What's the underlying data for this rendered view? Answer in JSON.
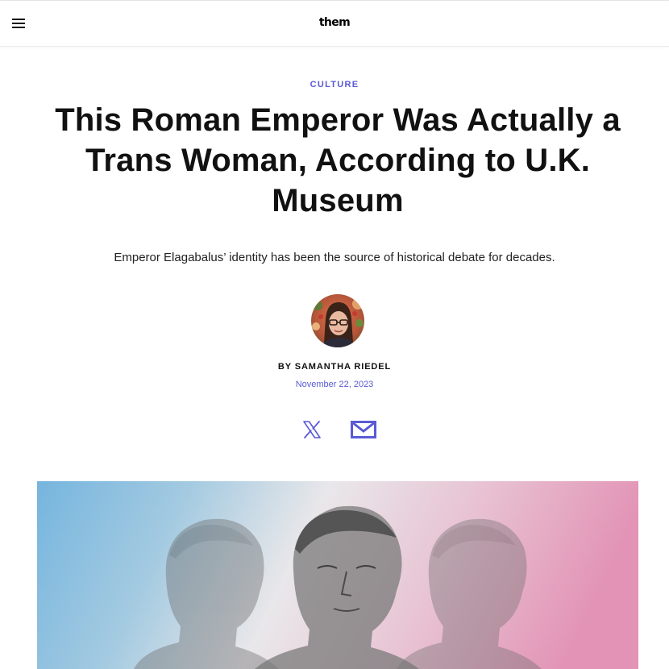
{
  "header": {
    "menu_icon": "hamburger-menu-icon",
    "logo": "them"
  },
  "article": {
    "category": "CULTURE",
    "headline": "This Roman Emperor Was Actually a Trans Woman, According to U.K. Museum",
    "dek": "Emperor Elagabalus’ identity has been the source of historical debate for decades.",
    "byline_prefix": "BY",
    "author": "SAMANTHA RIEDEL",
    "date": "November 22, 2023"
  },
  "share": {
    "icons": [
      "x-twitter-icon",
      "email-icon"
    ]
  },
  "colors": {
    "accent": "#5a5ad6",
    "text": "#111111",
    "gradient_blue": "#7fb8dd",
    "gradient_pink": "#e3a3bd"
  }
}
